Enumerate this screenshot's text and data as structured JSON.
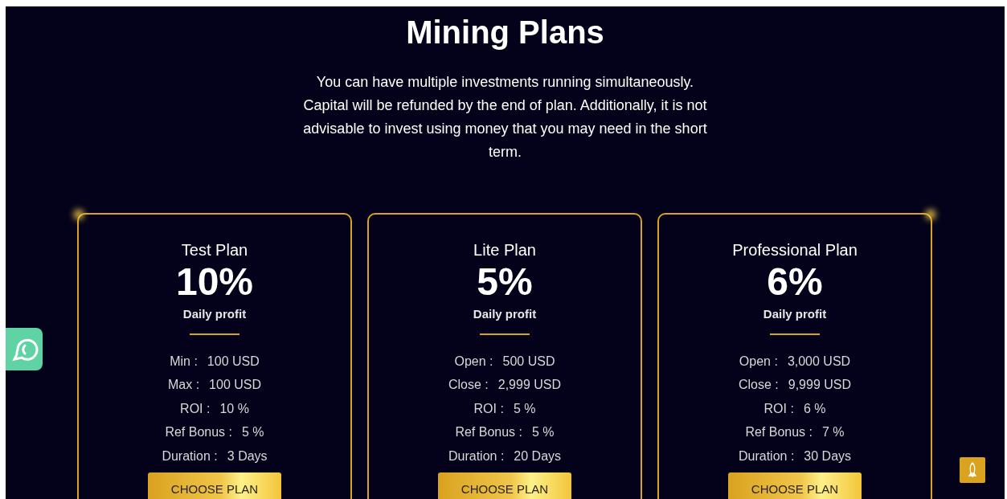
{
  "heading": "Mining Plans",
  "intro": "You can have multiple investments running simultaneously. Capital will be refunded by the end of plan. Additionally, it is not advisable to invest using money that you may need in the short term.",
  "plans": [
    {
      "name": "Test Plan",
      "rate": "10%",
      "rate_label": "Daily profit",
      "details": [
        {
          "label": "Min :",
          "value": "100 USD"
        },
        {
          "label": "Max :",
          "value": "100 USD"
        },
        {
          "label": "ROI :",
          "value": "10 %"
        },
        {
          "label": "Ref Bonus :",
          "value": "5 %"
        },
        {
          "label": "Duration :",
          "value": "3 Days"
        }
      ],
      "button": "CHOOSE PLAN"
    },
    {
      "name": "Lite Plan",
      "rate": "5%",
      "rate_label": "Daily profit",
      "details": [
        {
          "label": "Open :",
          "value": "500 USD"
        },
        {
          "label": "Close :",
          "value": "2,999 USD"
        },
        {
          "label": "ROI :",
          "value": "5 %"
        },
        {
          "label": "Ref Bonus :",
          "value": "5 %"
        },
        {
          "label": "Duration :",
          "value": "20 Days"
        }
      ],
      "button": "CHOOSE PLAN"
    },
    {
      "name": "Professional Plan",
      "rate": "6%",
      "rate_label": "Daily profit",
      "details": [
        {
          "label": "Open :",
          "value": "3,000 USD"
        },
        {
          "label": "Close :",
          "value": "9,999 USD"
        },
        {
          "label": "ROI :",
          "value": "6 %"
        },
        {
          "label": "Ref Bonus :",
          "value": "7 %"
        },
        {
          "label": "Duration :",
          "value": "30 Days"
        }
      ],
      "button": "CHOOSE PLAN"
    }
  ]
}
